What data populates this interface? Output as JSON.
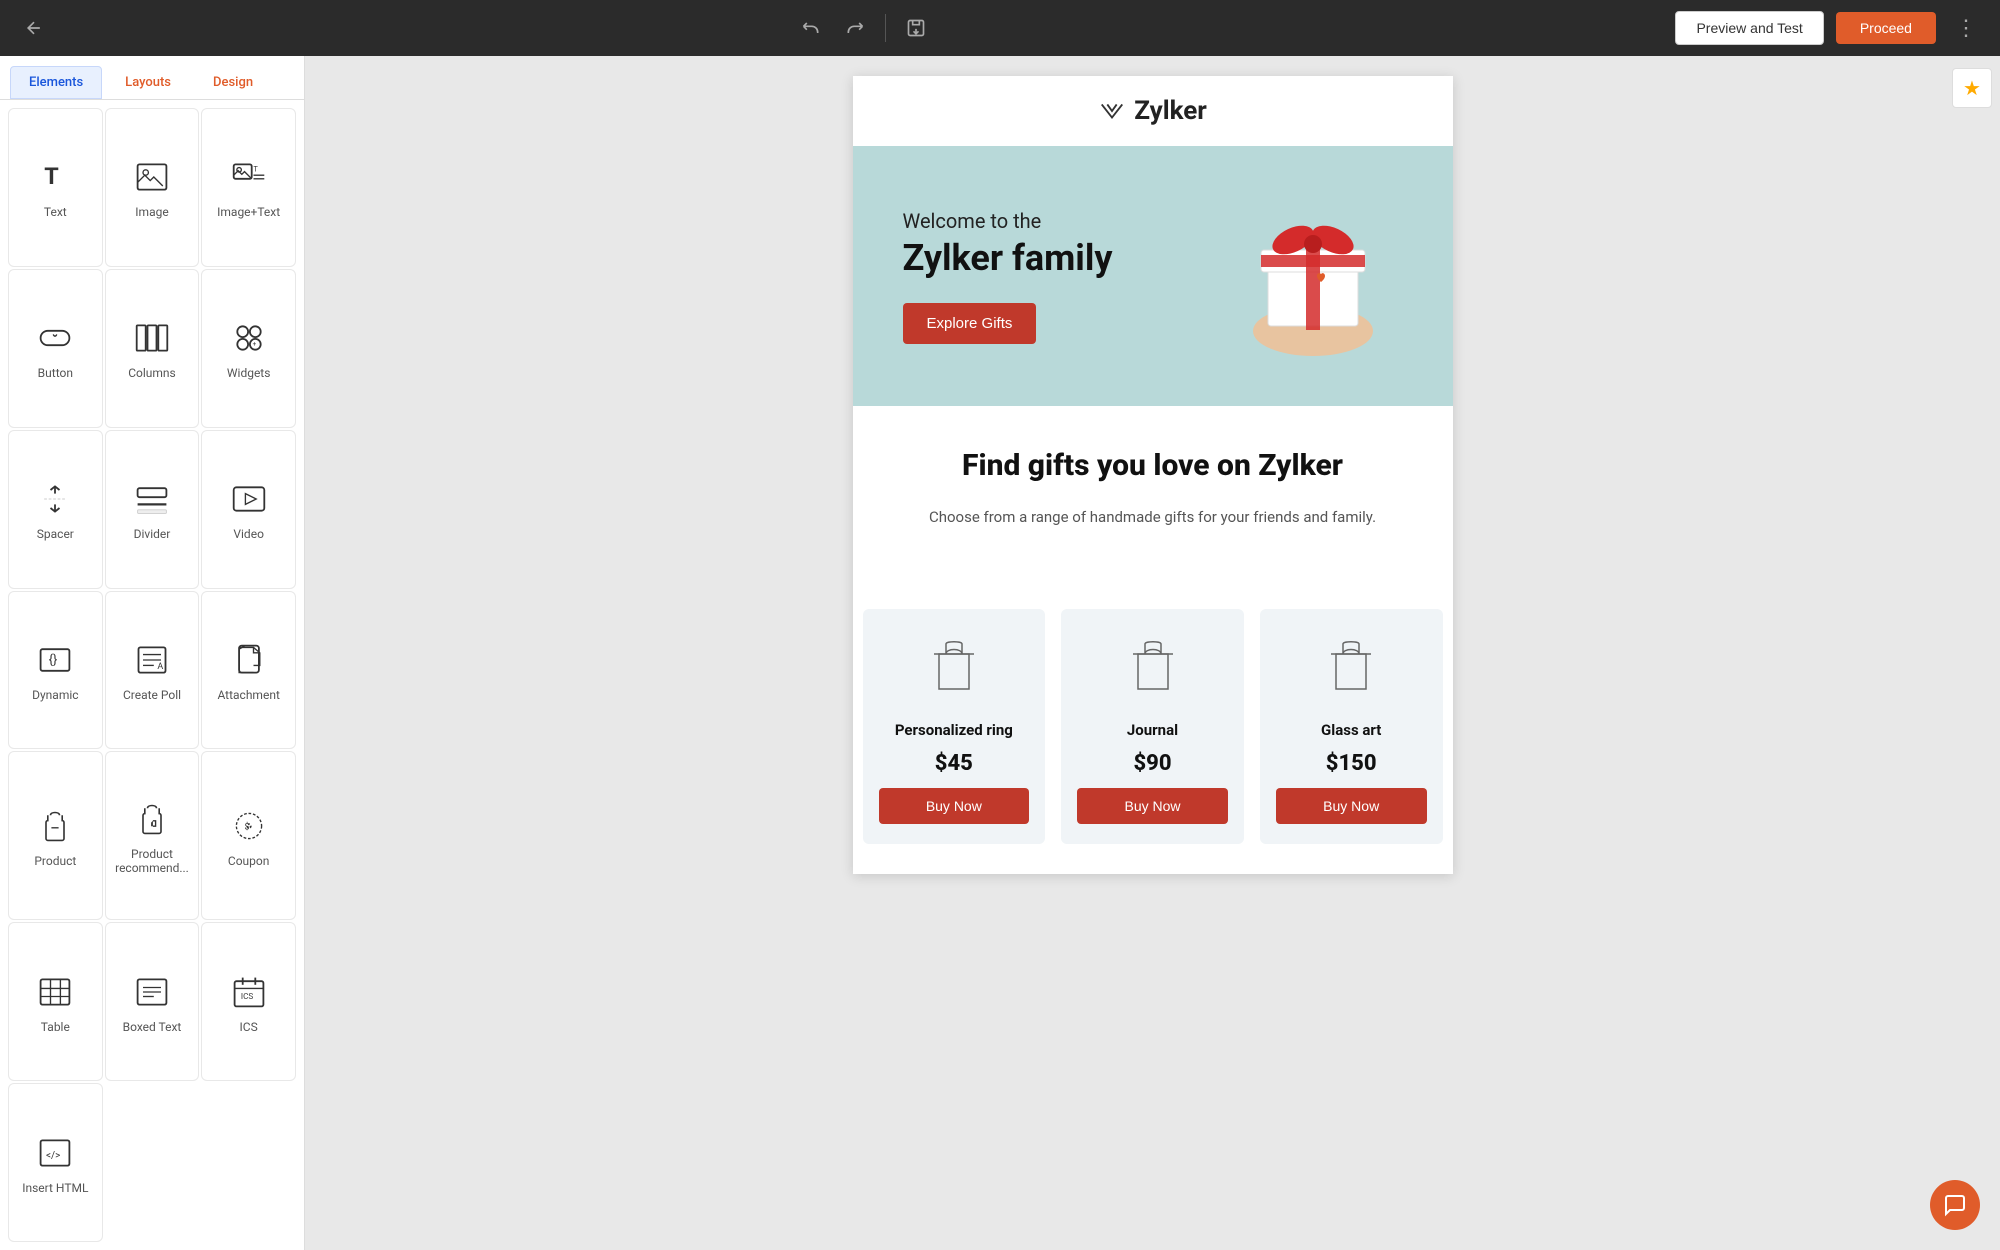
{
  "topbar": {
    "back_icon": "←",
    "forward_icon": "→",
    "save_icon": "💾",
    "preview_label": "Preview and Test",
    "proceed_label": "Proceed",
    "more_icon": "⋮"
  },
  "tabs": {
    "elements_label": "Elements",
    "layouts_label": "Layouts",
    "design_label": "Design"
  },
  "elements": [
    {
      "id": "text",
      "label": "Text",
      "icon": "text"
    },
    {
      "id": "image",
      "label": "Image",
      "icon": "image"
    },
    {
      "id": "image-text",
      "label": "Image+Text",
      "icon": "image-text"
    },
    {
      "id": "button",
      "label": "Button",
      "icon": "button"
    },
    {
      "id": "columns",
      "label": "Columns",
      "icon": "columns"
    },
    {
      "id": "widgets",
      "label": "Widgets",
      "icon": "widgets"
    },
    {
      "id": "spacer",
      "label": "Spacer",
      "icon": "spacer"
    },
    {
      "id": "divider",
      "label": "Divider",
      "icon": "divider"
    },
    {
      "id": "video",
      "label": "Video",
      "icon": "video"
    },
    {
      "id": "dynamic",
      "label": "Dynamic",
      "icon": "dynamic"
    },
    {
      "id": "create-poll",
      "label": "Create Poll",
      "icon": "poll"
    },
    {
      "id": "attachment",
      "label": "Attachment",
      "icon": "attachment"
    },
    {
      "id": "product",
      "label": "Product",
      "icon": "product"
    },
    {
      "id": "product-recommend",
      "label": "Product recommend...",
      "icon": "product-recommend"
    },
    {
      "id": "coupon",
      "label": "Coupon",
      "icon": "coupon"
    },
    {
      "id": "table",
      "label": "Table",
      "icon": "table"
    },
    {
      "id": "boxed-text",
      "label": "Boxed Text",
      "icon": "boxed-text"
    },
    {
      "id": "ics",
      "label": "ICS",
      "icon": "ics"
    },
    {
      "id": "insert-html",
      "label": "Insert HTML",
      "icon": "html"
    }
  ],
  "email": {
    "brand_name": "Zylker",
    "hero_subtitle": "Welcome to the",
    "hero_title": "Zylker family",
    "hero_button": "Explore Gifts",
    "main_heading": "Find gifts you love on Zylker",
    "sub_text": "Choose from a range of handmade gifts for your friends and family.",
    "products": [
      {
        "name": "Personalized ring",
        "price": "$45",
        "buy_label": "Buy Now"
      },
      {
        "name": "Journal",
        "price": "$90",
        "buy_label": "Buy Now"
      },
      {
        "name": "Glass art",
        "price": "$150",
        "buy_label": "Buy Now"
      }
    ]
  }
}
